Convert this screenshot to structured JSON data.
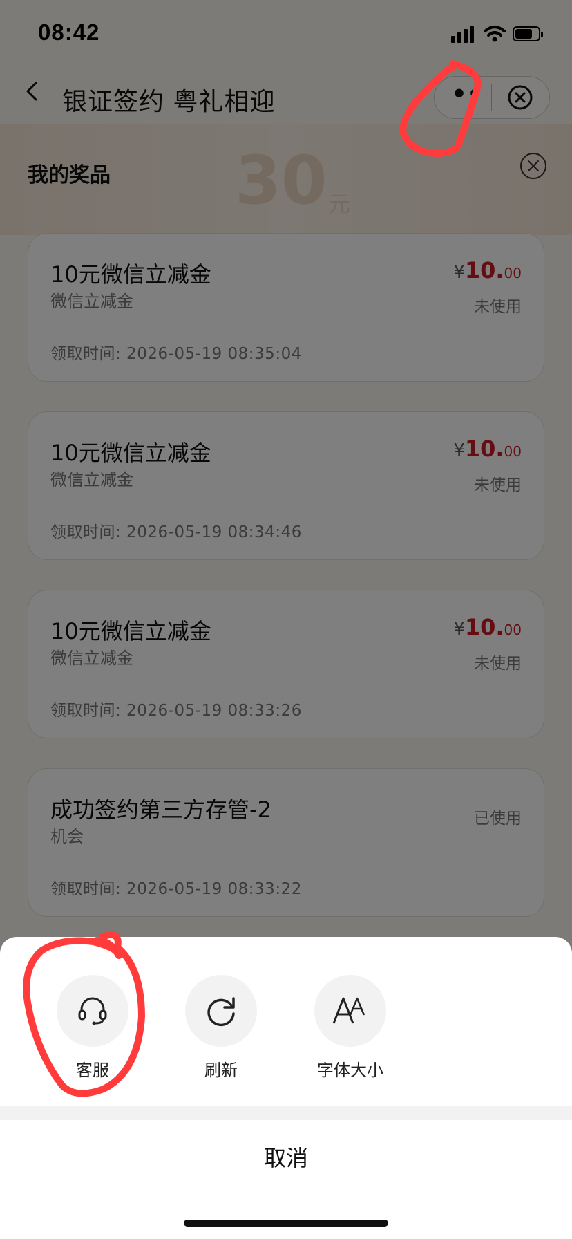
{
  "status_bar": {
    "time": "08:42"
  },
  "nav": {
    "title": "银证签约 粤礼相迎",
    "more_label": "••"
  },
  "background": {
    "banner_amount": "30",
    "banner_unit": "元"
  },
  "modal": {
    "title": "我的奖品",
    "cards": [
      {
        "title": "10元微信立减金",
        "subtitle": "微信立减金",
        "currency": "¥",
        "price_int": "10.",
        "price_dec": "00",
        "status": "未使用",
        "time": "领取时间: 2026-05-19 08:35:04"
      },
      {
        "title": "10元微信立减金",
        "subtitle": "微信立减金",
        "currency": "¥",
        "price_int": "10.",
        "price_dec": "00",
        "status": "未使用",
        "time": "领取时间: 2026-05-19 08:34:46"
      },
      {
        "title": "10元微信立减金",
        "subtitle": "微信立减金",
        "currency": "¥",
        "price_int": "10.",
        "price_dec": "00",
        "status": "未使用",
        "time": "领取时间: 2026-05-19 08:33:26"
      },
      {
        "title": "成功签约第三方存管-2",
        "subtitle": "机会",
        "status": "已使用",
        "time": "领取时间: 2026-05-19 08:33:22"
      }
    ]
  },
  "action_sheet": {
    "actions": [
      {
        "label": "客服",
        "icon": "headset-icon"
      },
      {
        "label": "刷新",
        "icon": "refresh-icon"
      },
      {
        "label": "字体大小",
        "icon": "font-size-icon"
      }
    ],
    "cancel_label": "取消"
  },
  "colors": {
    "price_red": "#c81c26",
    "annotation_red": "#ff3b3b",
    "overlay": "rgba(0,0,0,0.5)"
  }
}
